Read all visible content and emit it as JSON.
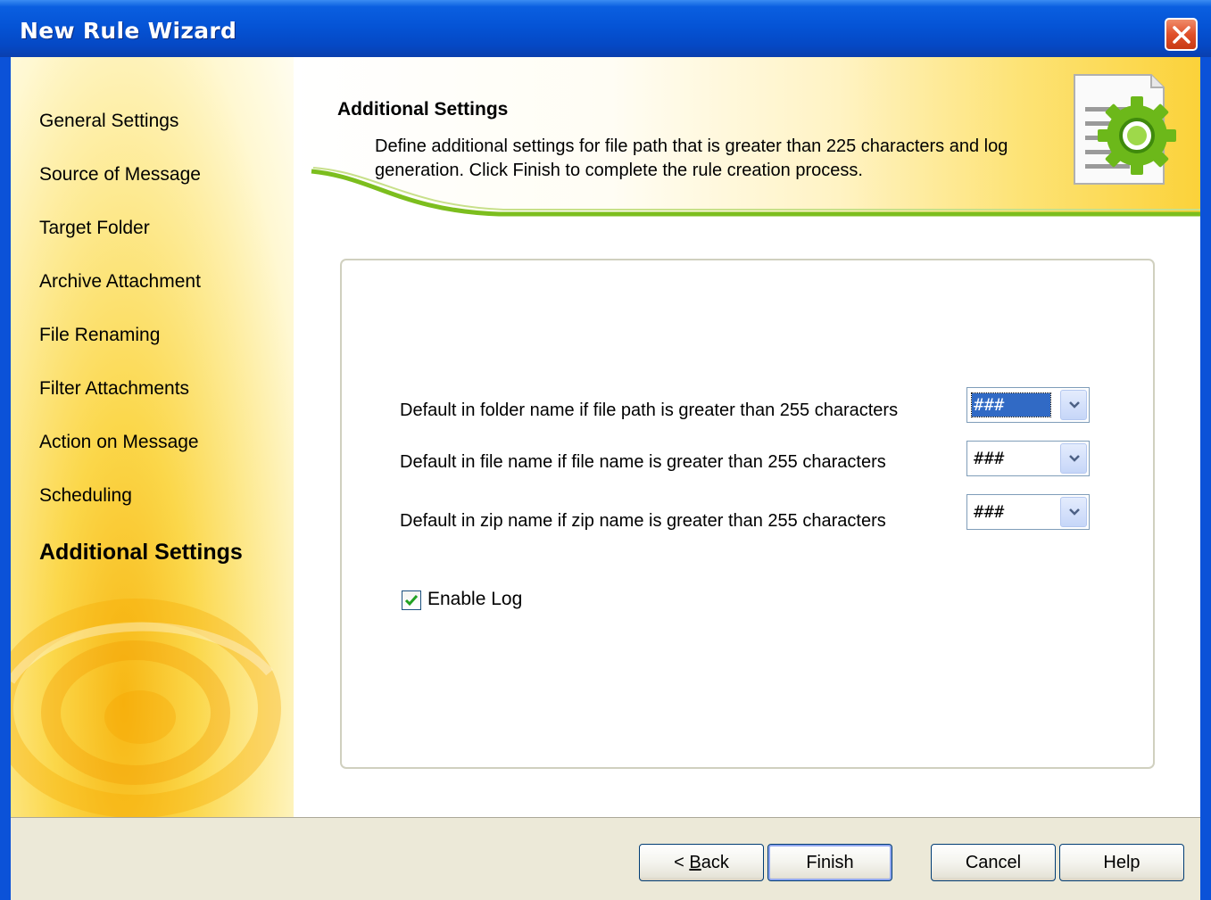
{
  "window": {
    "title": "New Rule Wizard"
  },
  "sidebar": {
    "items": [
      {
        "label": "General Settings"
      },
      {
        "label": "Source of Message"
      },
      {
        "label": "Target Folder"
      },
      {
        "label": "Archive Attachment"
      },
      {
        "label": "File Renaming"
      },
      {
        "label": "Filter Attachments"
      },
      {
        "label": "Action on Message"
      },
      {
        "label": "Scheduling"
      },
      {
        "label": "Additional Settings",
        "active": true
      }
    ]
  },
  "header": {
    "title": "Additional Settings",
    "description": "Define additional settings for file path that is greater than 225 characters and log generation. Click Finish to complete the rule creation process."
  },
  "options": [
    {
      "label": "Default in folder name if file path is greater than 255 characters",
      "value": "###",
      "selected": true
    },
    {
      "label": "Default in file name if file name is greater than 255 characters",
      "value": "###"
    },
    {
      "label": "Default in zip name if zip name is greater than 255 characters",
      "value": "###"
    }
  ],
  "enable_log": {
    "label": "Enable Log",
    "checked": true
  },
  "footer": {
    "back_prefix": "< ",
    "back_mnemonic": "B",
    "back_rest": "ack",
    "finish": "Finish",
    "cancel": "Cancel",
    "help": "Help"
  },
  "colors": {
    "titlebar": "#0554d6",
    "sidebar_accent": "#f7b714",
    "selection": "#316ac5",
    "footer_bg": "#ece9d8"
  },
  "icons": [
    "close-icon",
    "settings-document-icon",
    "chevron-down-icon",
    "checkmark-icon",
    "email-swirl-logo"
  ]
}
